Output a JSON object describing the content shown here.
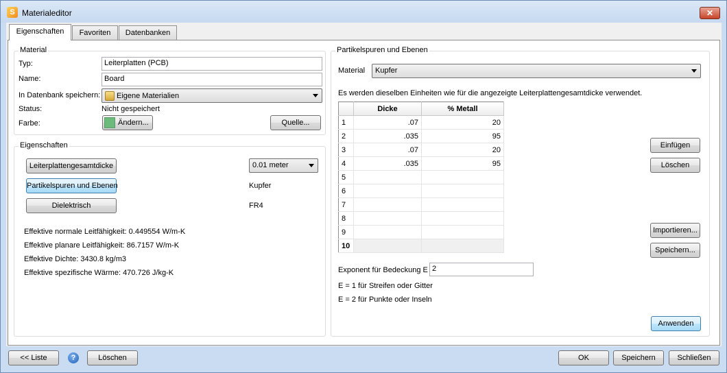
{
  "window": {
    "title": "Materialeditor",
    "close_label": "✕"
  },
  "tabs": [
    {
      "label": "Eigenschaften"
    },
    {
      "label": "Favoriten"
    },
    {
      "label": "Datenbanken"
    }
  ],
  "material": {
    "group_title": "Material",
    "typ_label": "Typ:",
    "typ_value": "Leiterplatten (PCB)",
    "name_label": "Name:",
    "name_value": "Board",
    "db_label": "In Datenbank speichern:",
    "db_value": "Eigene Materialien",
    "status_label": "Status:",
    "status_value": "Nicht gespeichert",
    "farbe_label": "Farbe:",
    "aendern_label": "Ändern...",
    "quelle_label": "Quelle...",
    "swatch_color": "#6dbb7c"
  },
  "eigenschaften": {
    "group_title": "Eigenschaften",
    "btn_gesamtdicke": "Leiterplattengesamtdicke",
    "unit_value": "0.01 meter",
    "btn_partikel": "Partikelspuren und Ebenen",
    "partikel_value": "Kupfer",
    "btn_dielektrisch": "Dielektrisch",
    "dielektrisch_value": "FR4",
    "props": [
      "Effektive normale Leitfähigkeit: 0.449554 W/m-K",
      "Effektive planare Leitfähigkeit: 86.7157 W/m-K",
      "Effektive Dichte: 3430.8 kg/m3",
      "Effektive spezifische Wärme: 470.726 J/kg-K"
    ]
  },
  "partikel": {
    "group_title": "Partikelspuren und Ebenen",
    "material_label": "Material",
    "material_value": "Kupfer",
    "info_text": "Es werden dieselben Einheiten wie für die angezeigte Leiterplattengesamtdicke verwendet.",
    "table": {
      "headers": [
        "Dicke",
        "% Metall"
      ],
      "rows": [
        {
          "n": "1",
          "dicke": ".07",
          "metall": "20"
        },
        {
          "n": "2",
          "dicke": ".035",
          "metall": "95"
        },
        {
          "n": "3",
          "dicke": ".07",
          "metall": "20"
        },
        {
          "n": "4",
          "dicke": ".035",
          "metall": "95"
        },
        {
          "n": "5",
          "dicke": "",
          "metall": ""
        },
        {
          "n": "6",
          "dicke": "",
          "metall": ""
        },
        {
          "n": "7",
          "dicke": "",
          "metall": ""
        },
        {
          "n": "8",
          "dicke": "",
          "metall": ""
        },
        {
          "n": "9",
          "dicke": "",
          "metall": ""
        },
        {
          "n": "10",
          "dicke": "",
          "metall": ""
        }
      ]
    },
    "einfuegen_label": "Einfügen",
    "loeschen_label": "Löschen",
    "importieren_label": "Importieren...",
    "speichern_label": "Speichern...",
    "exponent_label": "Exponent für Bedeckung E",
    "exponent_value": "2",
    "hint1": "E = 1 für Streifen oder Gitter",
    "hint2": "E = 2 für Punkte oder Inseln",
    "anwenden_label": "Anwenden"
  },
  "footer": {
    "liste_label": "<< Liste",
    "help_label": "?",
    "loeschen_label": "Löschen",
    "ok_label": "OK",
    "speichern_label": "Speichern",
    "schliessen_label": "Schließen"
  }
}
